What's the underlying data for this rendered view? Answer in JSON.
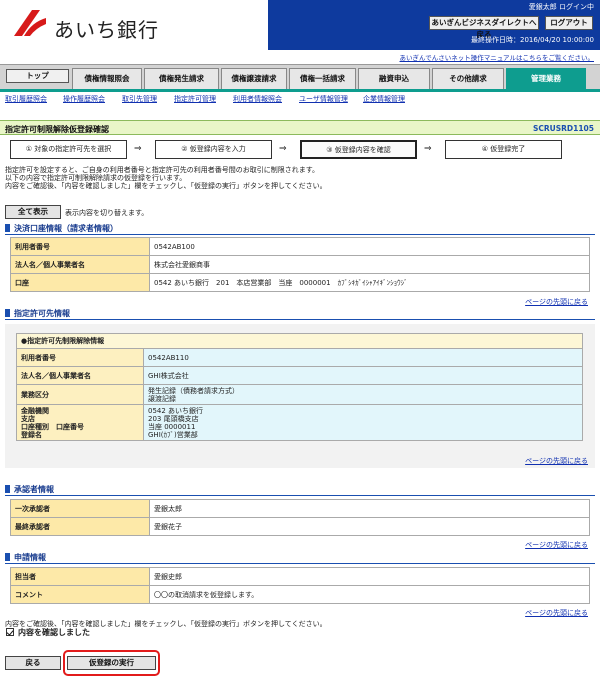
{
  "header": {
    "logo_text": "あいち銀行",
    "username": "愛銀太郎 ログイン中",
    "direct_button": "あいぎんビジネスダイレクトへ戻る",
    "logout_button": "ログアウト",
    "last_operation": "最終操作日時：2016/04/20 10:00:00",
    "manual_link": "あいぎんでんさいネット操作マニュアルはこちらをご覧ください。"
  },
  "tabs": [
    "トップ",
    "債権情報照会",
    "債権発生請求",
    "債権譲渡請求",
    "債権一括請求",
    "融資申込",
    "その他請求",
    "管理業務"
  ],
  "subnav": [
    "取引履歴照会",
    "操作履歴照会",
    "取引先管理",
    "指定許可管理",
    "利用者情報照会",
    "ユーザ情報管理",
    "企業情報管理"
  ],
  "page": {
    "title": "指定許可制限解除仮登録確認",
    "screen_id": "SCRUSRD1105"
  },
  "steps": [
    "① 対象の指定許可先を選択",
    "② 仮登録内容を入力",
    "③ 仮登録内容を確認",
    "④ 仮登録完了"
  ],
  "step_arrow": "⇒",
  "description": [
    "指定許可を設定すると、ご自身の利用者番号と指定許可先の利用者番号間のお取引に制限されます。",
    "以下の内容で指定許可制限解除請求の仮登録を行います。",
    "内容をご確認後、「内容を確認しました」欄をチェックし、「仮登録の実行」ボタンを押してください。"
  ],
  "show_all_button": "全て表示",
  "show_all_note": "表示内容を切り替えます。",
  "settlement": {
    "title": "決済口座情報（請求者情報）",
    "rows": [
      {
        "label": "利用者番号",
        "value": "0542AB100"
      },
      {
        "label": "法人名／個人事業者名",
        "value": "株式会社愛銀商事"
      },
      {
        "label": "口座",
        "value": "0542 あいち銀行　201　本店営業部　当座　0000001　ｶﾌﾞｼｷｶﾞｲｼｬｱｲｷﾞﾝｼｮｳｼﾞ"
      }
    ]
  },
  "to_top": "ページの先頭に戻る",
  "permitted": {
    "title": "指定許可先情報",
    "subtitle": "●指定許可先制限解除情報",
    "rows": [
      {
        "label": "利用者番号",
        "value": "0542AB110"
      },
      {
        "label": "法人名／個人事業者名",
        "value": "GHI株式会社"
      }
    ],
    "biz_label": "業務区分",
    "biz_values": [
      "発生記録（債務者請求方式）",
      "譲渡記録"
    ],
    "acct_labels": [
      "金融機関",
      "支店",
      "口座種別　口座番号",
      "登録名"
    ],
    "acct_values": [
      "0542 あいち銀行",
      "203 尾頭橋支店",
      "当座 0000011",
      "GHI(ｶﾌﾞ)営業部"
    ]
  },
  "approver": {
    "title": "承認者情報",
    "rows": [
      {
        "label": "一次承認者",
        "value": "愛銀太郎"
      },
      {
        "label": "最終承認者",
        "value": "愛銀花子"
      }
    ]
  },
  "applicant": {
    "title": "申請情報",
    "rows": [
      {
        "label": "担当者",
        "value": "愛銀史郎"
      },
      {
        "label": "コメント",
        "value": "〇〇の取消請求を仮登録します。"
      }
    ]
  },
  "confirm_note": "内容をご確認後、「内容を確認しました」欄をチェックし、「仮登録の実行」ボタンを押してください。",
  "confirm_label": "内容を確認しました",
  "back_button": "戻る",
  "execute_button": "仮登録の実行",
  "colors": {
    "navy": "#0e3a9e",
    "teal": "#0e9d8f",
    "highlight": "#e21b1b"
  }
}
